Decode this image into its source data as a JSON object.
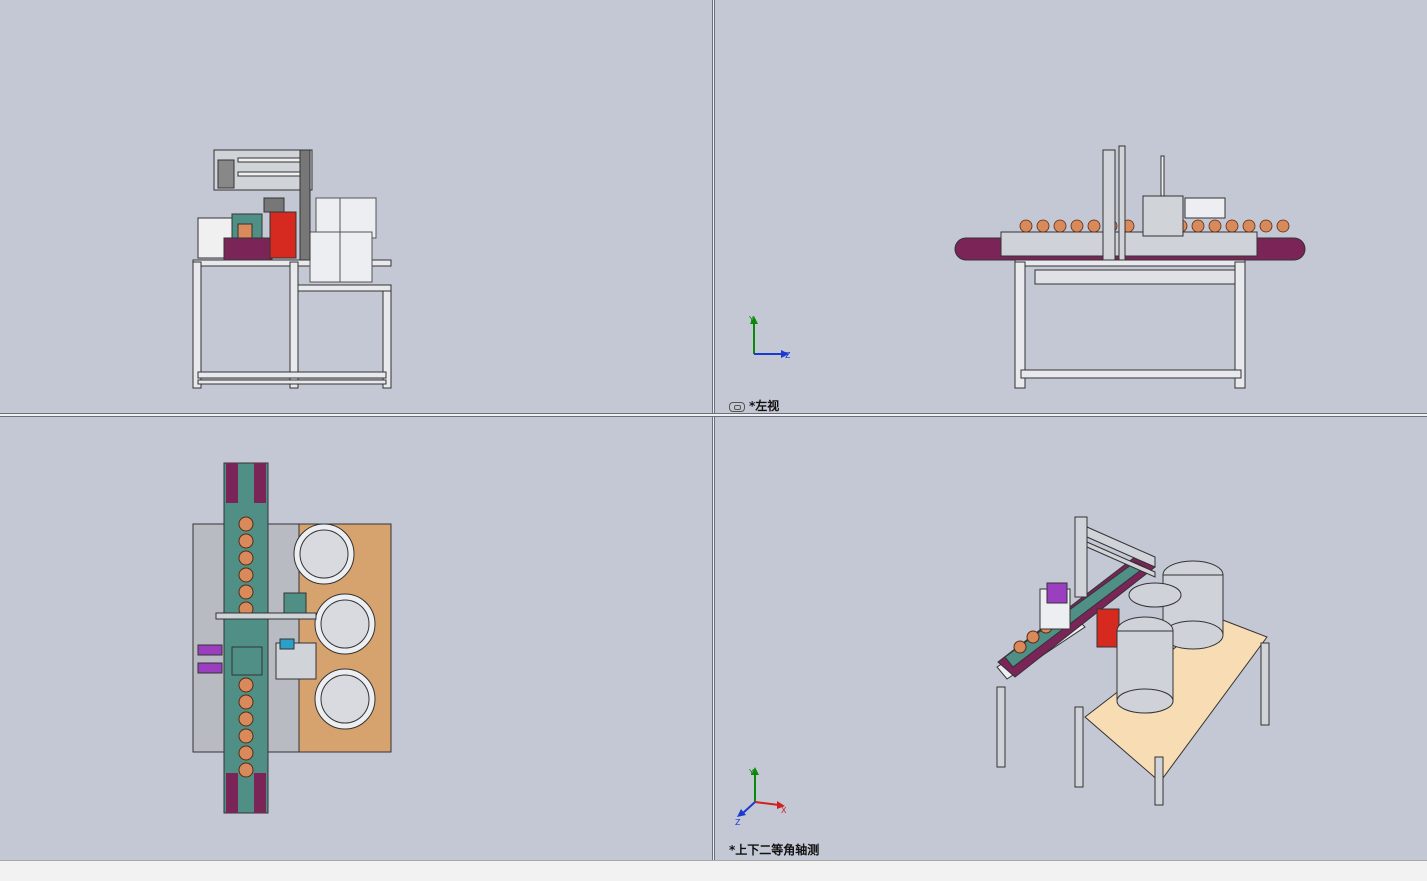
{
  "viewports": {
    "top_right": {
      "label": "*左视"
    },
    "bottom_right": {
      "label": "*上下二等角轴测"
    }
  },
  "triad": {
    "x": "X",
    "y": "Y",
    "z": "Z"
  },
  "colors": {
    "background": "#c4c8d4",
    "conveyor_purple": "#7a2458",
    "teal": "#4f8f86",
    "bottle": "#d88a5a",
    "plate": "#d6a36f",
    "frame": "#8a8c92"
  },
  "status": {
    "text": ""
  }
}
